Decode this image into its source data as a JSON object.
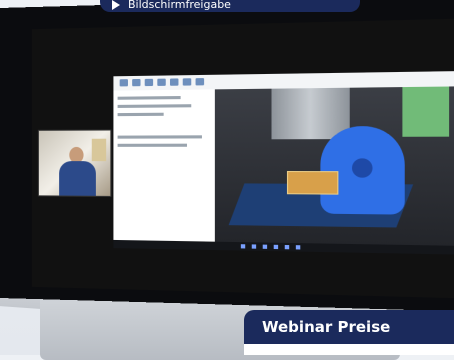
{
  "overlay": {
    "label": "Bildschirmfreigabe",
    "icon": "play-triangle-icon"
  },
  "badge": {
    "label": "Webinar Preise"
  },
  "colors": {
    "navy": "#1b2a5c",
    "rotary_blue": "#2f6fe6",
    "part_gold": "#d8a04a"
  }
}
